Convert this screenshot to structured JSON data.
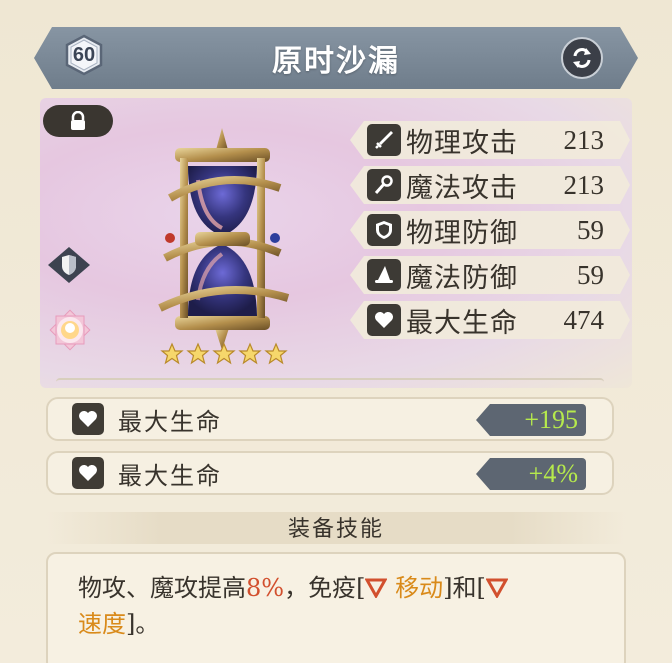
{
  "header": {
    "title": "原时沙漏",
    "level": "60"
  },
  "stats": [
    {
      "icon": "sword-icon",
      "label": "物理攻击",
      "value": "213"
    },
    {
      "icon": "wand-icon",
      "label": "魔法攻击",
      "value": "213"
    },
    {
      "icon": "shield-icon",
      "label": "物理防御",
      "value": "59"
    },
    {
      "icon": "wizard-hat-icon",
      "label": "魔法防御",
      "value": "59"
    },
    {
      "icon": "heart-icon",
      "label": "最大生命",
      "value": "474"
    }
  ],
  "stars": 5,
  "bonuses": [
    {
      "icon": "heart-icon",
      "label": "最大生命",
      "value": "+195"
    },
    {
      "icon": "heart-icon",
      "label": "最大生命",
      "value": "+4%"
    }
  ],
  "skill": {
    "title": "装备技能",
    "text_a": "物攻、魔攻提高",
    "pct": "8%",
    "text_b": "，免疫[",
    "effect1": "移动",
    "text_c": "]和[",
    "effect2": "速度",
    "text_d": "]。"
  },
  "colors": {
    "accent_green": "#b6ea4c",
    "header_bg": "#7d8b99",
    "highlight_red": "#d2502e",
    "highlight_orange": "#d98a1a"
  }
}
